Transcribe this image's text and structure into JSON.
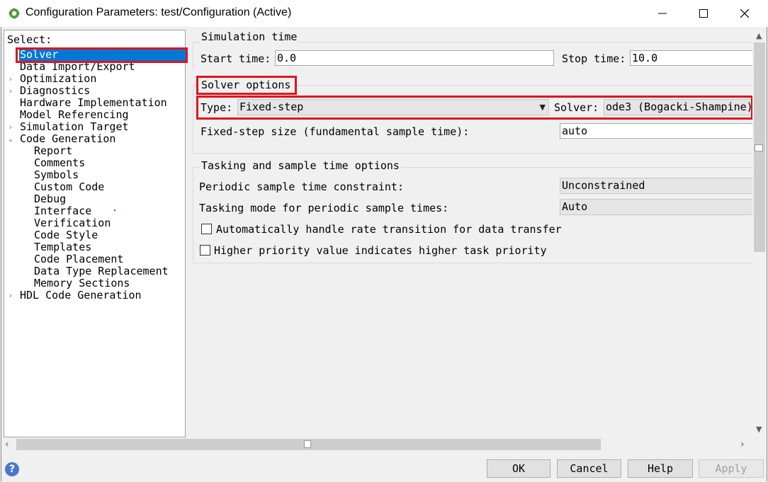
{
  "window": {
    "title": "Configuration Parameters: test/Configuration (Active)",
    "minimize": "–",
    "maximize": "☐",
    "close": "✕"
  },
  "tree": {
    "select_label": "Select:",
    "items": [
      {
        "label": "Solver",
        "selected": true,
        "caret": ""
      },
      {
        "label": "Data Import/Export",
        "caret": ""
      },
      {
        "label": "Optimization",
        "caret": "›"
      },
      {
        "label": "Diagnostics",
        "caret": "›"
      },
      {
        "label": "Hardware Implementation",
        "caret": ""
      },
      {
        "label": "Model Referencing",
        "caret": ""
      },
      {
        "label": "Simulation Target",
        "caret": "›"
      },
      {
        "label": "Code Generation",
        "caret": "⌄"
      },
      {
        "label": "Report",
        "caret": ""
      },
      {
        "label": "Comments",
        "caret": ""
      },
      {
        "label": "Symbols",
        "caret": ""
      },
      {
        "label": "Custom Code",
        "caret": ""
      },
      {
        "label": "Debug",
        "caret": ""
      },
      {
        "label": "Interface",
        "caret": ""
      },
      {
        "label": "Verification",
        "caret": ""
      },
      {
        "label": "Code Style",
        "caret": ""
      },
      {
        "label": "Templates",
        "caret": ""
      },
      {
        "label": "Code Placement",
        "caret": ""
      },
      {
        "label": "Data Type Replacement",
        "caret": ""
      },
      {
        "label": "Memory Sections",
        "caret": ""
      },
      {
        "label": "HDL Code Generation",
        "caret": "›"
      }
    ]
  },
  "simulation_time": {
    "title": "Simulation time",
    "start_label": "Start time:",
    "start_value": "0.0",
    "stop_label": "Stop time:",
    "stop_value": "10.0"
  },
  "solver_options": {
    "title": "Solver options",
    "type_label": "Type:",
    "type_value": "Fixed-step",
    "solver_label": "Solver:",
    "solver_value": "ode3 (Bogacki-Shampine)",
    "step_label": "Fixed-step size (fundamental sample time):",
    "step_value": "auto"
  },
  "tasking": {
    "title": "Tasking and sample time options",
    "periodic_label": "Periodic sample time constraint:",
    "periodic_value": "Unconstrained",
    "mode_label": "Tasking mode for periodic sample times:",
    "mode_value": "Auto",
    "auto_rate_label": "Automatically handle rate transition for data transfer",
    "priority_label": "Higher priority value indicates higher task priority"
  },
  "buttons": {
    "ok": "OK",
    "cancel": "Cancel",
    "help": "Help",
    "apply": "Apply"
  },
  "colors": {
    "highlight_red": "#e0141e",
    "selection_blue": "#0078d7"
  },
  "icons": {
    "app": "simulink-gear-icon",
    "help": "help-question-icon"
  }
}
